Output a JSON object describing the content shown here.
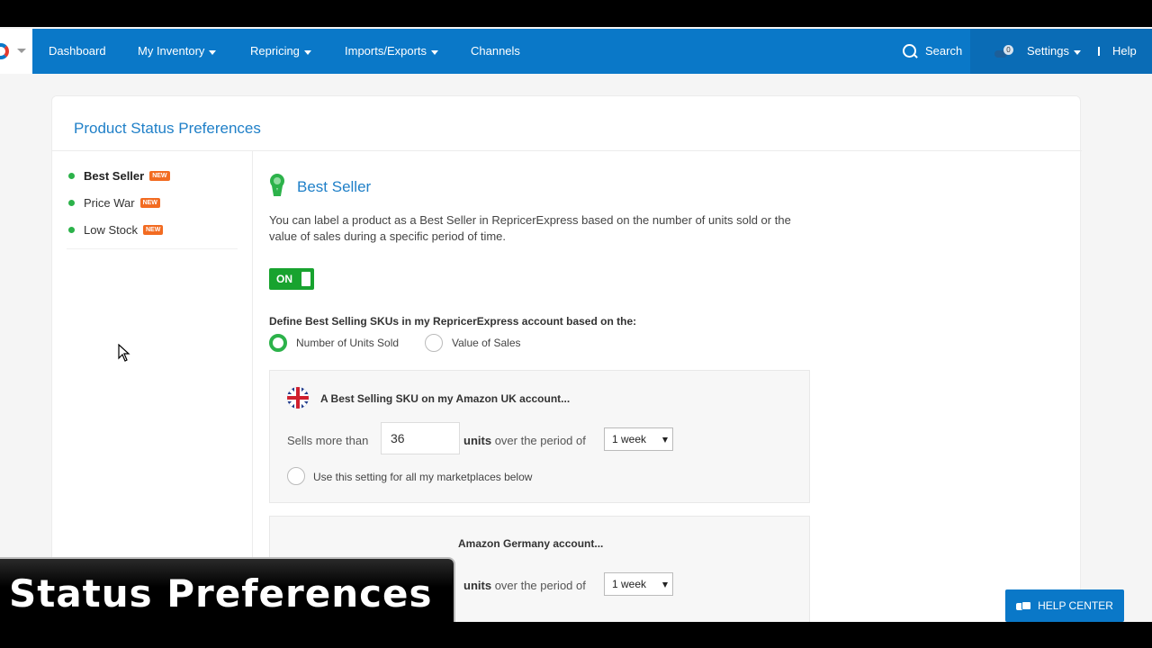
{
  "nav": {
    "items": [
      {
        "label": "Dashboard",
        "has_caret": false
      },
      {
        "label": "My Inventory",
        "has_caret": true
      },
      {
        "label": "Repricing",
        "has_caret": true
      },
      {
        "label": "Imports/Exports",
        "has_caret": true
      },
      {
        "label": "Channels",
        "has_caret": false
      }
    ],
    "search_label": "Search",
    "notifications_count": "0",
    "settings_label": "Settings",
    "separator": "|",
    "help_label": "Help",
    "accent_color": "#0a78c8"
  },
  "page": {
    "title": "Product Status Preferences"
  },
  "sidebar": {
    "items": [
      {
        "label": "Best Seller",
        "tag": "NEW",
        "active": true
      },
      {
        "label": "Price War",
        "tag": "NEW",
        "active": false
      },
      {
        "label": "Low Stock",
        "tag": "NEW",
        "active": false
      }
    ]
  },
  "section": {
    "icon": "award-ribbon-icon",
    "title": "Best Seller",
    "description": "You can label a product as a Best Seller in RepricerExpress based on the number of units sold or the value of sales during a specific period of time.",
    "toggle_label": "ON",
    "toggle_on": true,
    "define_label": "Define Best Selling SKUs in my RepricerExpress account based on the:",
    "options": [
      {
        "label": "Number of Units Sold",
        "selected": true
      },
      {
        "label": "Value of Sales",
        "selected": false
      }
    ]
  },
  "marketplaces": [
    {
      "flag": "uk-flag-icon",
      "title": "A Best Selling SKU on my Amazon UK account...",
      "sells_label": "Sells more than",
      "units_value": "36",
      "units_label": "units",
      "period_label": "over the period of",
      "period_value": "1 week",
      "apply_all_label": "Use this setting for all my marketplaces below"
    },
    {
      "title_visible": "Amazon Germany account...",
      "units_label": "units",
      "period_label": "over the period of",
      "period_value": "1 week"
    }
  ],
  "overlay": {
    "caption": "Status Preferences"
  },
  "help_center": {
    "label": "HELP CENTER"
  }
}
